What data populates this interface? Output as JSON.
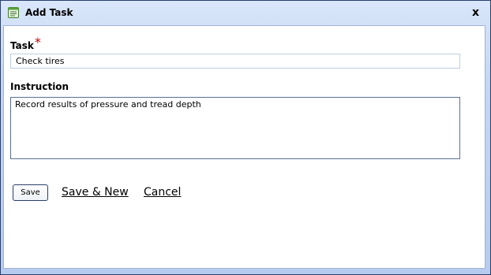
{
  "window": {
    "title": "Add Task",
    "icon": "notepad-icon",
    "close_glyph": "x"
  },
  "form": {
    "task_label": "Task",
    "required_marker": "*",
    "task_value": "Check tires",
    "instruction_label": "Instruction",
    "instruction_value": "Record results of pressure and tread depth"
  },
  "actions": {
    "save_label": "Save",
    "save_new_label": "Save & New",
    "cancel_label": "Cancel"
  },
  "colors": {
    "required_star": "#c00000",
    "titlebar_gradient_top": "#d9e6fa",
    "titlebar_gradient_bottom": "#b7cbee"
  }
}
